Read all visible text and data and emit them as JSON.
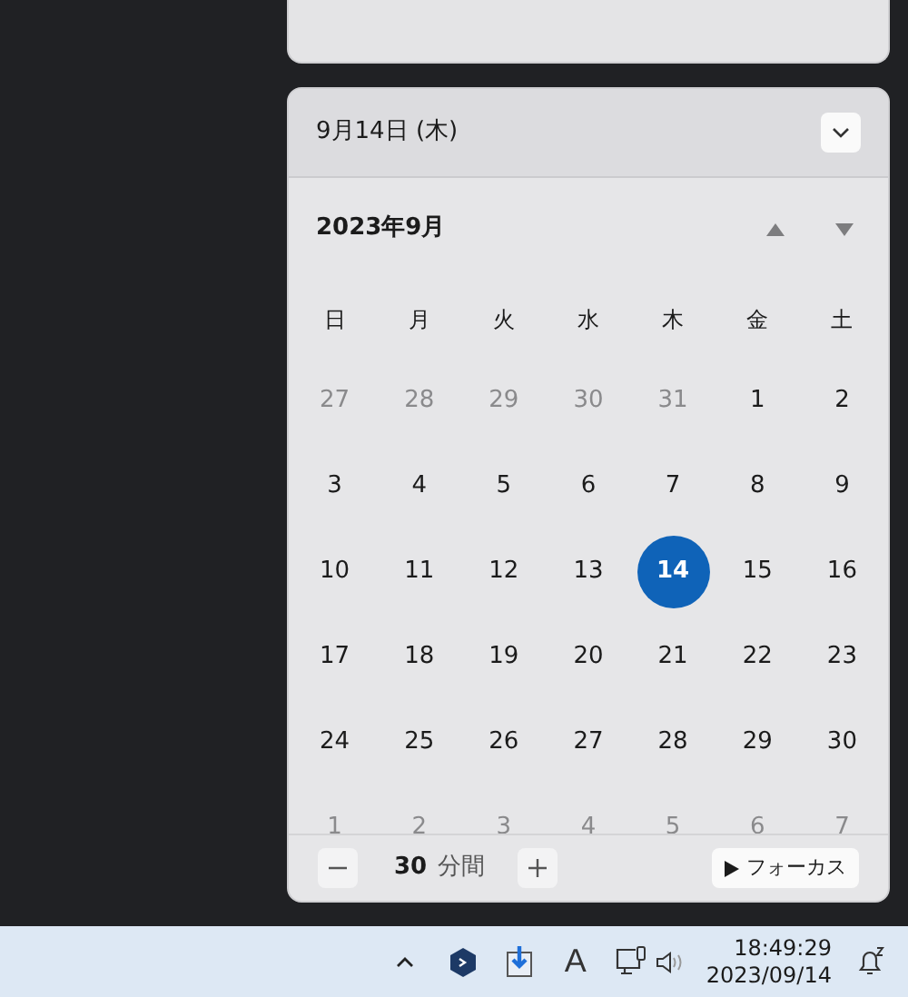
{
  "date_header": {
    "title": "9月14日 (木)"
  },
  "calendar": {
    "month": "2023年9月",
    "weekdays": [
      "日",
      "月",
      "火",
      "水",
      "木",
      "金",
      "土"
    ],
    "days": [
      {
        "label": "27",
        "outside": true,
        "selected": false
      },
      {
        "label": "28",
        "outside": true,
        "selected": false
      },
      {
        "label": "29",
        "outside": true,
        "selected": false
      },
      {
        "label": "30",
        "outside": true,
        "selected": false
      },
      {
        "label": "31",
        "outside": true,
        "selected": false
      },
      {
        "label": "1",
        "outside": false,
        "selected": false
      },
      {
        "label": "2",
        "outside": false,
        "selected": false
      },
      {
        "label": "3",
        "outside": false,
        "selected": false
      },
      {
        "label": "4",
        "outside": false,
        "selected": false
      },
      {
        "label": "5",
        "outside": false,
        "selected": false
      },
      {
        "label": "6",
        "outside": false,
        "selected": false
      },
      {
        "label": "7",
        "outside": false,
        "selected": false
      },
      {
        "label": "8",
        "outside": false,
        "selected": false
      },
      {
        "label": "9",
        "outside": false,
        "selected": false
      },
      {
        "label": "10",
        "outside": false,
        "selected": false
      },
      {
        "label": "11",
        "outside": false,
        "selected": false
      },
      {
        "label": "12",
        "outside": false,
        "selected": false
      },
      {
        "label": "13",
        "outside": false,
        "selected": false
      },
      {
        "label": "14",
        "outside": false,
        "selected": true
      },
      {
        "label": "15",
        "outside": false,
        "selected": false
      },
      {
        "label": "16",
        "outside": false,
        "selected": false
      },
      {
        "label": "17",
        "outside": false,
        "selected": false
      },
      {
        "label": "18",
        "outside": false,
        "selected": false
      },
      {
        "label": "19",
        "outside": false,
        "selected": false
      },
      {
        "label": "20",
        "outside": false,
        "selected": false
      },
      {
        "label": "21",
        "outside": false,
        "selected": false
      },
      {
        "label": "22",
        "outside": false,
        "selected": false
      },
      {
        "label": "23",
        "outside": false,
        "selected": false
      },
      {
        "label": "24",
        "outside": false,
        "selected": false
      },
      {
        "label": "25",
        "outside": false,
        "selected": false
      },
      {
        "label": "26",
        "outside": false,
        "selected": false
      },
      {
        "label": "27",
        "outside": false,
        "selected": false
      },
      {
        "label": "28",
        "outside": false,
        "selected": false
      },
      {
        "label": "29",
        "outside": false,
        "selected": false
      },
      {
        "label": "30",
        "outside": false,
        "selected": false
      },
      {
        "label": "1",
        "outside": true,
        "selected": false
      },
      {
        "label": "2",
        "outside": true,
        "selected": false
      },
      {
        "label": "3",
        "outside": true,
        "selected": false
      },
      {
        "label": "4",
        "outside": true,
        "selected": false
      },
      {
        "label": "5",
        "outside": true,
        "selected": false
      },
      {
        "label": "6",
        "outside": true,
        "selected": false
      },
      {
        "label": "7",
        "outside": true,
        "selected": false
      }
    ]
  },
  "focus": {
    "minutes": "30",
    "unit": "分間",
    "start_button": "フォーカス"
  },
  "taskbar": {
    "ime": "A",
    "time": "18:49:29",
    "date": "2023/09/14"
  }
}
